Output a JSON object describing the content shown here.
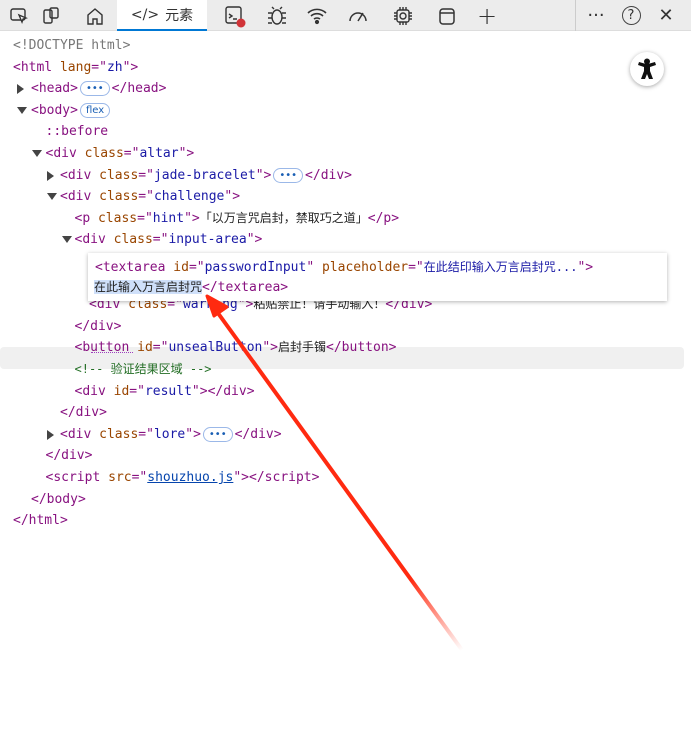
{
  "toolbar": {
    "tabs": [
      {
        "icon": "inspect-icon"
      },
      {
        "icon": "device-emulation-icon"
      },
      {
        "icon": "home-icon"
      },
      {
        "icon": "elements-icon",
        "label": "元素",
        "active": true
      },
      {
        "icon": "console-icon",
        "error_badge": true
      },
      {
        "icon": "bug-icon"
      },
      {
        "icon": "network-wifi-icon"
      },
      {
        "icon": "performance-gauge-icon"
      },
      {
        "icon": "memory-chip-icon"
      },
      {
        "icon": "application-panel-icon"
      },
      {
        "icon": "plus-icon"
      }
    ],
    "more": "···",
    "help": "?",
    "close": "✕"
  },
  "tree": [
    {
      "indent": 0,
      "toggle": null,
      "tokens": [
        {
          "k": "d",
          "s": "<!DOCTYPE html>"
        }
      ]
    },
    {
      "indent": 0,
      "toggle": null,
      "tokens": [
        {
          "k": "t",
          "s": "<html "
        },
        {
          "k": "a",
          "s": "lang"
        },
        {
          "k": "t",
          "s": "=\""
        },
        {
          "k": "v",
          "s": "zh"
        },
        {
          "k": "t",
          "s": "\">"
        }
      ]
    },
    {
      "indent": 1,
      "toggle": "collapsed",
      "tokens": [
        {
          "k": "t",
          "s": "<head>"
        },
        {
          "k": "badge",
          "s": "•••"
        },
        {
          "k": "t",
          "s": "</head>"
        }
      ]
    },
    {
      "indent": 1,
      "toggle": "expanded",
      "tokens": [
        {
          "k": "t",
          "s": "<body>"
        },
        {
          "k": "badge",
          "s": "flex"
        }
      ]
    },
    {
      "indent": 2,
      "toggle": null,
      "tokens": [
        {
          "k": "t",
          "s": "::before"
        }
      ]
    },
    {
      "indent": 2,
      "toggle": "expanded",
      "tokens": [
        {
          "k": "t",
          "s": "<div "
        },
        {
          "k": "a",
          "s": "class"
        },
        {
          "k": "t",
          "s": "=\""
        },
        {
          "k": "v",
          "s": "altar"
        },
        {
          "k": "t",
          "s": "\">"
        }
      ]
    },
    {
      "indent": 3,
      "toggle": "collapsed",
      "tokens": [
        {
          "k": "t",
          "s": "<div "
        },
        {
          "k": "a",
          "s": "class"
        },
        {
          "k": "t",
          "s": "=\""
        },
        {
          "k": "v",
          "s": "jade-bracelet"
        },
        {
          "k": "t",
          "s": "\">"
        },
        {
          "k": "badge",
          "s": "•••"
        },
        {
          "k": "t",
          "s": "</div>"
        }
      ]
    },
    {
      "indent": 3,
      "toggle": "expanded",
      "tokens": [
        {
          "k": "t",
          "s": "<div "
        },
        {
          "k": "a",
          "s": "class"
        },
        {
          "k": "t",
          "s": "=\""
        },
        {
          "k": "v",
          "s": "challenge"
        },
        {
          "k": "t",
          "s": "\">"
        }
      ]
    },
    {
      "indent": 4,
      "toggle": null,
      "tokens": [
        {
          "k": "t",
          "s": "<p "
        },
        {
          "k": "a",
          "s": "class"
        },
        {
          "k": "t",
          "s": "=\""
        },
        {
          "k": "v",
          "s": "hint"
        },
        {
          "k": "t",
          "s": "\">"
        },
        {
          "k": "x",
          "s": "「以万言咒启封，禁取巧之道」"
        },
        {
          "k": "t",
          "s": "</p>"
        }
      ]
    },
    {
      "indent": 4,
      "toggle": "expanded",
      "tokens": [
        {
          "k": "t",
          "s": "<div "
        },
        {
          "k": "a",
          "s": "class"
        },
        {
          "k": "t",
          "s": "=\""
        },
        {
          "k": "v",
          "s": "input-area"
        },
        {
          "k": "t",
          "s": "\">"
        }
      ]
    },
    {
      "indent": 5,
      "toggle": null,
      "tokens": [],
      "hidden_by_popup": true
    },
    {
      "indent": 5,
      "toggle": null,
      "tokens": []
    },
    {
      "indent": 5,
      "toggle": null,
      "tokens": [
        {
          "k": "t",
          "s": "<div "
        },
        {
          "k": "a",
          "s": "class"
        },
        {
          "k": "t",
          "s": "=\""
        },
        {
          "k": "v",
          "s": "warning"
        },
        {
          "k": "t",
          "s": "\">"
        },
        {
          "k": "x",
          "s": "粘贴禁止！请手动输入！"
        },
        {
          "k": "t",
          "s": "</div>"
        }
      ]
    },
    {
      "indent": 4,
      "toggle": null,
      "tokens": [
        {
          "k": "t",
          "s": "</div>"
        }
      ]
    },
    {
      "indent": 4,
      "toggle": null,
      "tokens": [
        {
          "k": "t",
          "s": "<button "
        },
        {
          "k": "a",
          "s": "id"
        },
        {
          "k": "t",
          "s": "=\""
        },
        {
          "k": "v",
          "s": "unsealButton"
        },
        {
          "k": "t",
          "s": "\">"
        },
        {
          "k": "x",
          "s": "启封手镯"
        },
        {
          "k": "t",
          "s": "</button>"
        }
      ],
      "hovered": true
    },
    {
      "indent": 4,
      "toggle": null,
      "tokens": [
        {
          "k": "c",
          "s": "<!-- 验证结果区域 -->"
        }
      ]
    },
    {
      "indent": 4,
      "toggle": null,
      "tokens": [
        {
          "k": "t",
          "s": "<div "
        },
        {
          "k": "a",
          "s": "id"
        },
        {
          "k": "t",
          "s": "=\""
        },
        {
          "k": "v",
          "s": "result"
        },
        {
          "k": "t",
          "s": "\"></div>"
        }
      ]
    },
    {
      "indent": 3,
      "toggle": null,
      "tokens": [
        {
          "k": "t",
          "s": "</div>"
        }
      ]
    },
    {
      "indent": 3,
      "toggle": "collapsed",
      "tokens": [
        {
          "k": "t",
          "s": "<div "
        },
        {
          "k": "a",
          "s": "class"
        },
        {
          "k": "t",
          "s": "=\""
        },
        {
          "k": "v",
          "s": "lore"
        },
        {
          "k": "t",
          "s": "\">"
        },
        {
          "k": "badge",
          "s": "•••"
        },
        {
          "k": "t",
          "s": "</div>"
        }
      ]
    },
    {
      "indent": 2,
      "toggle": null,
      "tokens": [
        {
          "k": "t",
          "s": "</div>"
        }
      ]
    },
    {
      "indent": 2,
      "toggle": null,
      "tokens": [
        {
          "k": "t",
          "s": "<script "
        },
        {
          "k": "a",
          "s": "src"
        },
        {
          "k": "t",
          "s": "=\""
        },
        {
          "k": "l",
          "s": "shouzhuo.js"
        },
        {
          "k": "t",
          "s": "\"></script>"
        }
      ]
    },
    {
      "indent": 1,
      "toggle": null,
      "tokens": [
        {
          "k": "t",
          "s": "</body>"
        }
      ]
    },
    {
      "indent": 0,
      "toggle": null,
      "tokens": [
        {
          "k": "t",
          "s": "</html>"
        }
      ]
    }
  ],
  "popup": {
    "line1": [
      {
        "k": "t",
        "s": "<textarea "
      },
      {
        "k": "a",
        "s": "id"
      },
      {
        "k": "t",
        "s": "=\""
      },
      {
        "k": "v",
        "s": "passwordInput"
      },
      {
        "k": "t",
        "s": "\" "
      },
      {
        "k": "a",
        "s": "placeholder"
      },
      {
        "k": "t",
        "s": "=\""
      },
      {
        "k": "v",
        "s": "在此结印输入万言启封咒..."
      },
      {
        "k": "t",
        "s": "\">"
      }
    ],
    "selected_text": "在此输入万言启封咒",
    "closing": "</textarea>"
  },
  "annotation": {
    "arrow_color": "#ff2a10"
  },
  "colors": {
    "tag": "#881280",
    "attr": "#994500",
    "value": "#1a1aa6",
    "comment": "#236e25",
    "accent": "#0078d4"
  }
}
